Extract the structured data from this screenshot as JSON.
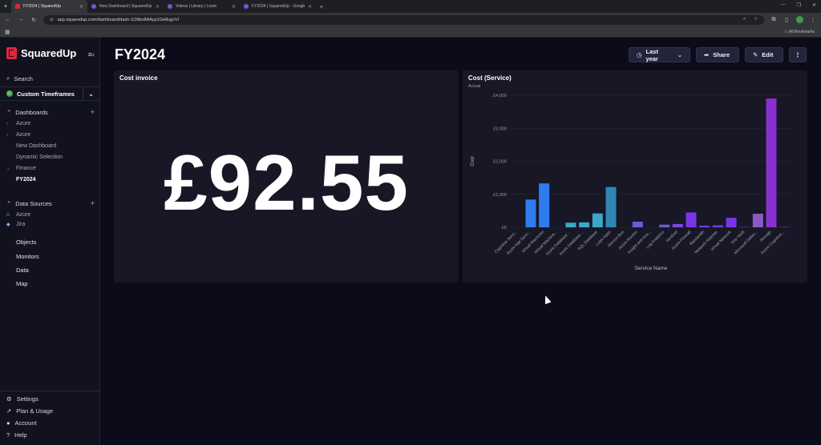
{
  "browser": {
    "tabs": [
      {
        "title": "FY2024 | SquaredUp",
        "active": true
      },
      {
        "title": "New Dashboard | SquaredUp",
        "active": false
      },
      {
        "title": "Videos | Library | Loom",
        "active": false
      },
      {
        "title": "FY2024 | SquaredUp - Google",
        "active": false
      }
    ],
    "url": "app.squaredup.com/dashboard/dash-1O9bo8AAyp1Ge8ugvVl",
    "all_bookmarks": "All Bookmarks",
    "profile_initial": "D"
  },
  "sidebar": {
    "brand": "SquaredUp",
    "search": "Search",
    "timeframe": "Custom Timeframes",
    "dashboards_label": "Dashboards",
    "dashboards": [
      {
        "label": "Azure"
      },
      {
        "label": "Azure"
      },
      {
        "label": "New Dashboard"
      },
      {
        "label": "Dynamic Selection"
      },
      {
        "label": "Finance"
      },
      {
        "label": "FY2024"
      }
    ],
    "datasources_label": "Data Sources",
    "datasources": [
      {
        "label": "Azure"
      },
      {
        "label": "Jira"
      }
    ],
    "nav": [
      "Objects",
      "Monitors",
      "Data",
      "Map"
    ],
    "bottom": [
      "Settings",
      "Plan & Usage",
      "Account",
      "Help"
    ]
  },
  "header": {
    "title": "FY2024",
    "timeframe_label": "Last year",
    "share_label": "Share",
    "edit_label": "Edit"
  },
  "tiles": {
    "invoice": {
      "title": "Cost invoice",
      "value": "£92.55"
    },
    "service": {
      "title": "Cost (Service)",
      "subtitle": "Actual"
    }
  },
  "chart_data": {
    "type": "bar",
    "title": "Cost (Service)",
    "subtitle": "Actual",
    "xlabel": "Service Name",
    "ylabel": "Cost",
    "ylim": [
      0,
      4000
    ],
    "yticks": [
      "£0",
      "£1,000",
      "£2,000",
      "£3,000",
      "£4,000"
    ],
    "grid": true,
    "categories": [
      "Cognitive Servi...",
      "Azure App Servi...",
      "Virtual Machines",
      "Virtual Machine...",
      "Azure Database ...",
      "Azure Database ...",
      "SQL Database",
      "Logic Apps",
      "Service Bus",
      "Azure Monitor",
      "Insight and Ana...",
      "Log Analytics",
      "Sentinel",
      "Azure Firewall",
      "Bandwidth",
      "Network Watcher",
      "Virtual Network",
      "Key Vault",
      "Microsoft Defen...",
      "Storage",
      "Azure Cognitive..."
    ],
    "values": [
      0,
      840,
      1330,
      0,
      140,
      150,
      420,
      1220,
      0,
      170,
      0,
      80,
      100,
      450,
      50,
      60,
      290,
      10,
      410,
      3900,
      10
    ],
    "colors": [
      "#2e7cf0",
      "#2e7cf0",
      "#2e7cf0",
      "#2e7cf0",
      "#3ca7c8",
      "#3ca7c8",
      "#3ca7c8",
      "#2e86b5",
      "#5b6ad8",
      "#6b5bd6",
      "#6b5bd6",
      "#6b5bd6",
      "#7a48e0",
      "#7a36e6",
      "#7a36e6",
      "#7a36e6",
      "#7a36e6",
      "#7a36e6",
      "#8a5ac6",
      "#8a2fd0",
      "#8a2fd0"
    ]
  }
}
